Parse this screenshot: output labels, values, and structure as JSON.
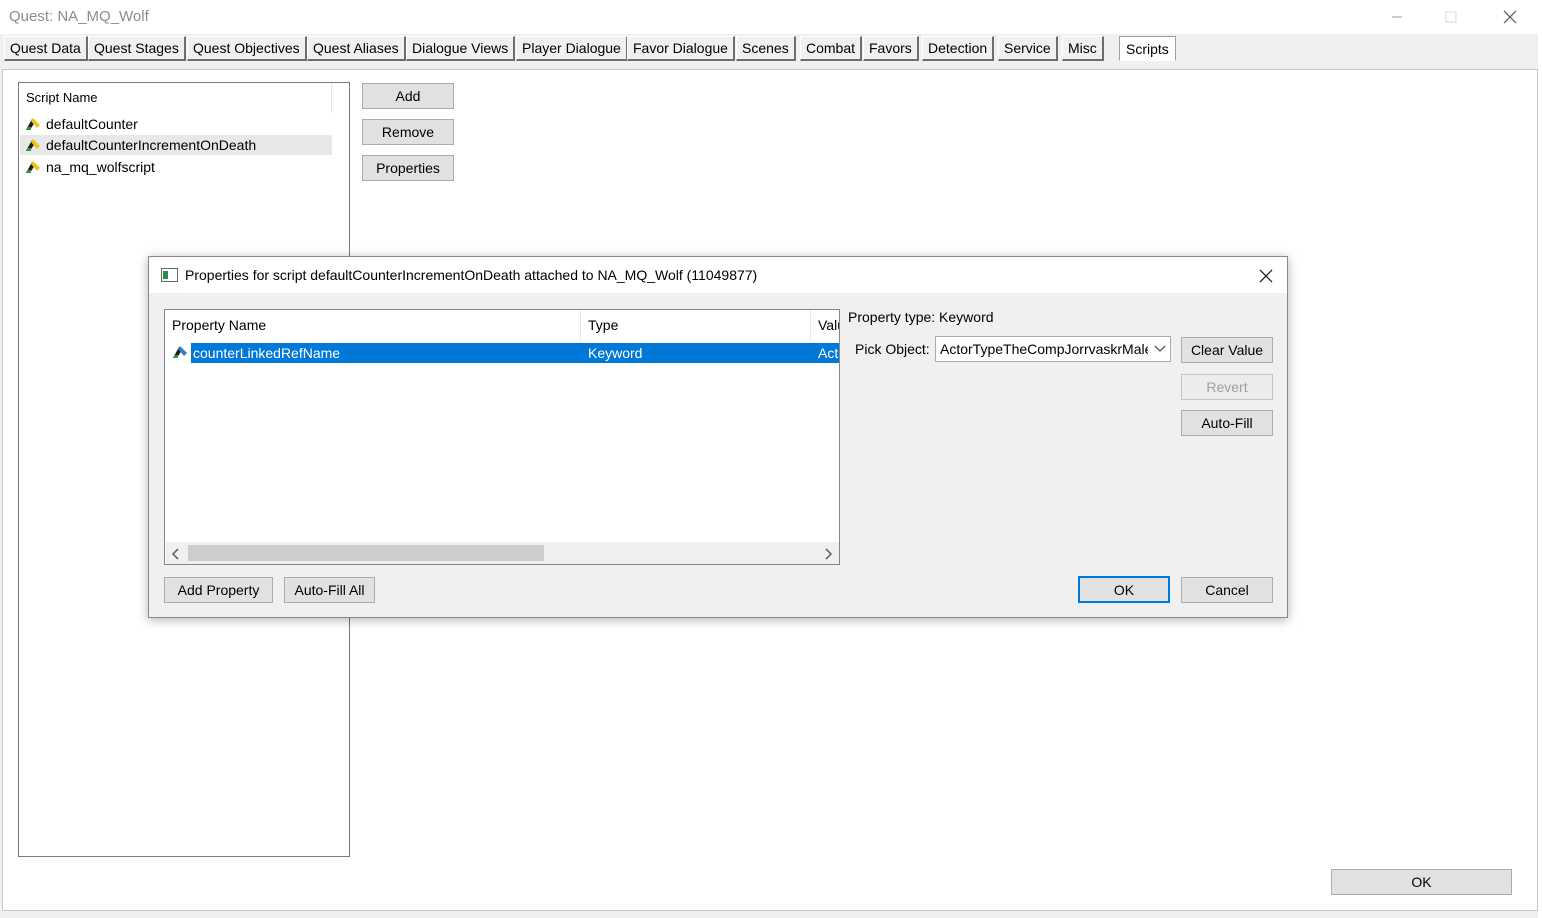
{
  "window": {
    "title": "Quest: NA_MQ_Wolf"
  },
  "tabs": [
    "Quest Data",
    "Quest Stages",
    "Quest Objectives",
    "Quest Aliases",
    "Dialogue Views",
    "Player Dialogue",
    "Favor Dialogue",
    "Scenes",
    "Combat",
    "Favors",
    "Detection",
    "Service",
    "Misc",
    "Scripts"
  ],
  "active_tab": "Scripts",
  "script_list": {
    "header": "Script Name",
    "items": [
      "defaultCounter",
      "defaultCounterIncrementOnDeath",
      "na_mq_wolfscript"
    ],
    "selected": "defaultCounterIncrementOnDeath"
  },
  "buttons": {
    "add": "Add",
    "remove": "Remove",
    "properties": "Properties",
    "ok": "OK"
  },
  "dialog": {
    "title": "Properties for script defaultCounterIncrementOnDeath attached to NA_MQ_Wolf (11049877)",
    "columns": [
      "Property Name",
      "Type",
      "Value"
    ],
    "rows": [
      {
        "name": "counterLinkedRefName",
        "type": "Keyword",
        "value": "ActorTypeTheCompJorrvaskrMaleNPC"
      }
    ],
    "property_type_label": "Property type:",
    "property_type_value": "Keyword",
    "pick_object_label": "Pick Object:",
    "pick_object_value": "ActorTypeTheCompJorrvaskrMaleNPC",
    "buttons": {
      "clear_value": "Clear Value",
      "revert": "Revert",
      "auto_fill": "Auto-Fill",
      "add_property": "Add Property",
      "auto_fill_all": "Auto-Fill All",
      "ok": "OK",
      "cancel": "Cancel"
    }
  }
}
